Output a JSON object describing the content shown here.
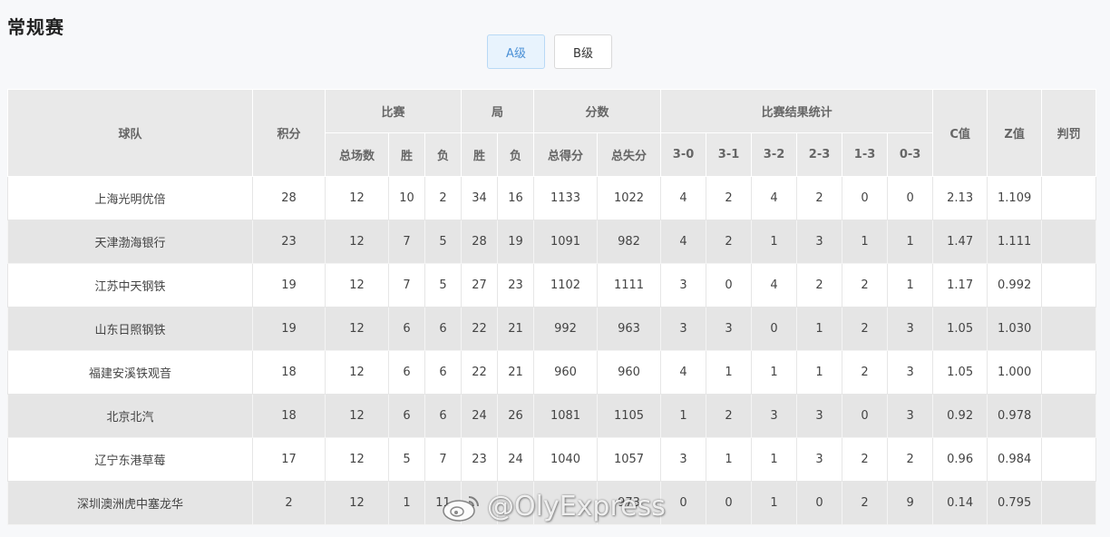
{
  "page": {
    "title": "常规赛"
  },
  "level_tabs": [
    {
      "label": "A级",
      "active": true
    },
    {
      "label": "B级",
      "active": false
    }
  ],
  "table": {
    "headers": {
      "team": "球队",
      "points": "积分",
      "match_group": "比赛",
      "set_group": "局",
      "score_group": "分数",
      "result_group": "比赛结果统计",
      "c_value": "C值",
      "z_value": "Z值",
      "penalty": "判罚",
      "sub": [
        "总场数",
        "胜",
        "负",
        "胜",
        "负",
        "总得分",
        "总失分",
        "3-0",
        "3-1",
        "3-2",
        "2-3",
        "1-3",
        "0-3"
      ]
    },
    "rows": [
      [
        "上海光明优倍",
        "28",
        "12",
        "10",
        "2",
        "34",
        "16",
        "1133",
        "1022",
        "4",
        "2",
        "4",
        "2",
        "0",
        "0",
        "2.13",
        "1.109",
        ""
      ],
      [
        "天津渤海银行",
        "23",
        "12",
        "7",
        "5",
        "28",
        "19",
        "1091",
        "982",
        "4",
        "2",
        "1",
        "3",
        "1",
        "1",
        "1.47",
        "1.111",
        ""
      ],
      [
        "江苏中天钢铁",
        "19",
        "12",
        "7",
        "5",
        "27",
        "23",
        "1102",
        "1111",
        "3",
        "0",
        "4",
        "2",
        "2",
        "1",
        "1.17",
        "0.992",
        ""
      ],
      [
        "山东日照钢铁",
        "19",
        "12",
        "6",
        "6",
        "22",
        "21",
        "992",
        "963",
        "3",
        "3",
        "0",
        "1",
        "2",
        "3",
        "1.05",
        "1.030",
        ""
      ],
      [
        "福建安溪铁观音",
        "18",
        "12",
        "6",
        "6",
        "22",
        "21",
        "960",
        "960",
        "4",
        "1",
        "1",
        "1",
        "2",
        "3",
        "1.05",
        "1.000",
        ""
      ],
      [
        "北京北汽",
        "18",
        "12",
        "6",
        "6",
        "24",
        "26",
        "1081",
        "1105",
        "1",
        "2",
        "3",
        "3",
        "0",
        "3",
        "0.92",
        "0.978",
        ""
      ],
      [
        "辽宁东港草莓",
        "17",
        "12",
        "5",
        "7",
        "23",
        "24",
        "1040",
        "1057",
        "3",
        "1",
        "1",
        "3",
        "2",
        "2",
        "0.96",
        "0.984",
        ""
      ],
      [
        "深圳澳洲虎中塞龙华",
        "2",
        "12",
        "1",
        "11",
        "",
        "",
        "",
        "973",
        "0",
        "0",
        "1",
        "0",
        "2",
        "9",
        "0.14",
        "0.795",
        ""
      ]
    ]
  },
  "watermark": {
    "text": "@OlyExpress",
    "icon": "weibo-icon"
  }
}
